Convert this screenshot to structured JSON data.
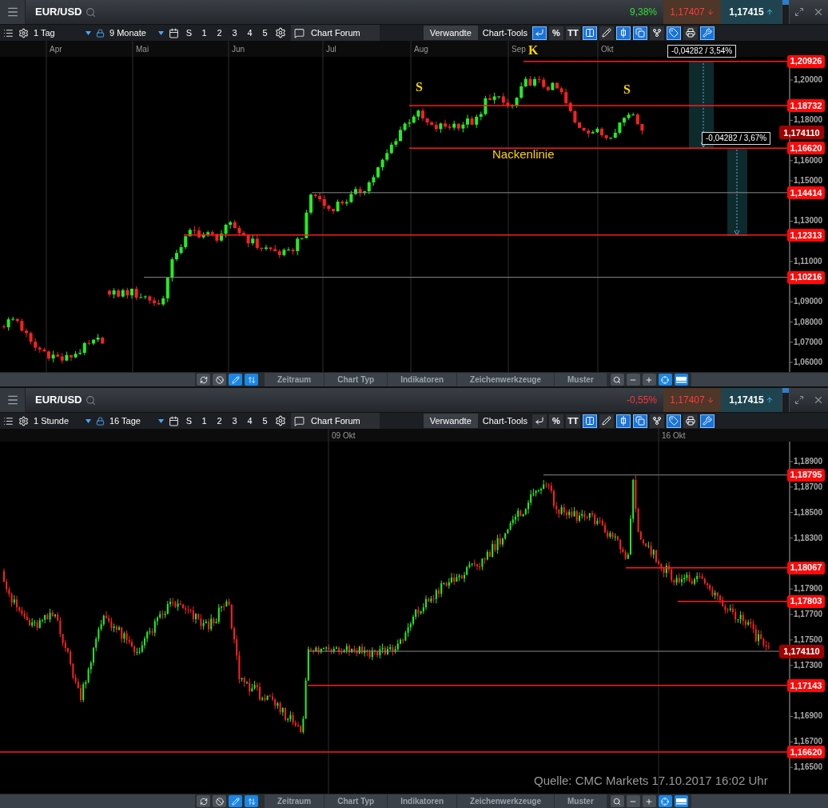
{
  "panels": [
    {
      "symbol": "EUR/USD",
      "change": "9,38%",
      "sell": "1,17407",
      "buy": "1,17415",
      "interval": "1 Tag",
      "range": "9 Monate",
      "quick_buttons": [
        "S",
        "1",
        "2",
        "3",
        "4",
        "5"
      ],
      "forum": "Chart Forum",
      "related": "Verwandte",
      "tools_label": "Chart-Tools",
      "tools": [
        {
          "kind": "icon",
          "selected": true
        },
        {
          "kind": "text",
          "label": "%",
          "selected": false
        },
        {
          "kind": "text",
          "label": "TT",
          "selected": false
        },
        {
          "kind": "icon",
          "selected": true
        },
        {
          "kind": "icon",
          "selected": false
        },
        {
          "kind": "icon",
          "selected": true
        },
        {
          "kind": "icon",
          "selected": true
        },
        {
          "kind": "icon",
          "selected": false
        },
        {
          "kind": "icon",
          "selected": true
        },
        {
          "kind": "icon",
          "selected": false
        },
        {
          "kind": "icon",
          "selected": true
        }
      ],
      "x_labels": [
        "Apr",
        "Mai",
        "Jun",
        "Jul",
        "Aug",
        "Sep",
        "Okt"
      ],
      "y_ticks": [
        "1,20000",
        "1,18000",
        "1,16000",
        "1,15000",
        "1,13000",
        "1,11000",
        "1,09000",
        "1,08000",
        "1,07000",
        "1,06000"
      ],
      "levels": [
        {
          "price": "1,20926"
        },
        {
          "price": "1,18732"
        },
        {
          "price": "1,16620"
        },
        {
          "price": "1,14414"
        },
        {
          "price": "1,12313"
        },
        {
          "price": "1,10216"
        }
      ],
      "current_price": "1,174110",
      "annotations": [
        {
          "kind": "marker",
          "text": "S"
        },
        {
          "kind": "marker",
          "text": "K"
        },
        {
          "kind": "marker",
          "text": "S"
        },
        {
          "kind": "caption",
          "text": "Nackenlinie"
        },
        {
          "kind": "measure",
          "text": "-0,04282 / 3,54%"
        },
        {
          "kind": "measure",
          "text": "-0,04282 / 3,67%"
        }
      ],
      "bottom_tabs": [
        "Zeitraum",
        "Chart Typ",
        "Indikatoren",
        "Zeichenwerkzeuge",
        "Muster"
      ]
    },
    {
      "symbol": "EUR/USD",
      "change": "-0,55%",
      "sell": "1,17407",
      "buy": "1,17415",
      "interval": "1 Stunde",
      "range": "16 Tage",
      "quick_buttons": [
        "S",
        "1",
        "2",
        "3",
        "4",
        "5"
      ],
      "forum": "Chart Forum",
      "related": "Verwandte",
      "tools_label": "Chart-Tools",
      "tools": [
        {
          "kind": "icon",
          "selected": false
        },
        {
          "kind": "text",
          "label": "%",
          "selected": false
        },
        {
          "kind": "text",
          "label": "TT",
          "selected": false
        },
        {
          "kind": "icon",
          "selected": true
        },
        {
          "kind": "icon",
          "selected": false
        },
        {
          "kind": "icon",
          "selected": true
        },
        {
          "kind": "icon",
          "selected": true
        },
        {
          "kind": "icon",
          "selected": false
        },
        {
          "kind": "icon",
          "selected": true
        },
        {
          "kind": "icon",
          "selected": false
        },
        {
          "kind": "icon",
          "selected": true
        }
      ],
      "x_labels": [
        "09 Okt",
        "16 Okt"
      ],
      "y_ticks": [
        "1,18900",
        "1,18700",
        "1,18500",
        "1,18300",
        "1,17900",
        "1,17700",
        "1,17500",
        "1,17300",
        "1,16900",
        "1,16700",
        "1,16500"
      ],
      "levels": [
        {
          "price": "1,18795"
        },
        {
          "price": "1,18067"
        },
        {
          "price": "1,17803"
        },
        {
          "price": "1,17143"
        },
        {
          "price": "1,16620"
        }
      ],
      "current_price": "1,174110",
      "annotations": [
        {
          "kind": "source",
          "text": "Quelle: CMC Markets 17.10.2017 16:02 Uhr"
        }
      ],
      "bottom_tabs": [
        "Zeitraum",
        "Chart Typ",
        "Indikatoren",
        "Zeichenwerkzeuge",
        "Muster"
      ]
    }
  ]
}
